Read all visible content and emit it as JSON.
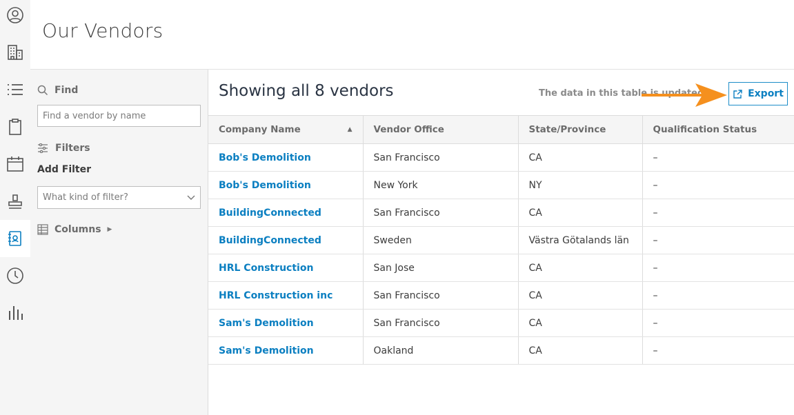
{
  "rail": {
    "icons": [
      "user-circle-icon",
      "building-icon",
      "list-icon",
      "clipboard-icon",
      "calendar-icon",
      "stamp-icon",
      "vendor-book-icon",
      "clock-icon",
      "bar-chart-icon"
    ],
    "active_index": 6
  },
  "page": {
    "title": "Our Vendors"
  },
  "sidebar": {
    "find_label": "Find",
    "find_placeholder": "Find a vendor by name",
    "filters_label": "Filters",
    "add_filter_label": "Add Filter",
    "filter_placeholder": "What kind of filter?",
    "columns_label": "Columns"
  },
  "main": {
    "showing_text": "Showing all 8 vendors",
    "notice_text": "The data in this table is updated",
    "export_label": "Export",
    "columns": [
      "Company Name",
      "Vendor Office",
      "State/Province",
      "Qualification Status"
    ],
    "rows": [
      {
        "company": "Bob's Demolition",
        "office": "San Francisco",
        "state": "CA",
        "status": "–"
      },
      {
        "company": "Bob's Demolition",
        "office": "New York",
        "state": "NY",
        "status": "–"
      },
      {
        "company": "BuildingConnected",
        "office": "San Francisco",
        "state": "CA",
        "status": "–"
      },
      {
        "company": "BuildingConnected",
        "office": "Sweden",
        "state": "Västra Götalands län",
        "status": "–"
      },
      {
        "company": "HRL Construction",
        "office": "San Jose",
        "state": "CA",
        "status": "–"
      },
      {
        "company": "HRL Construction inc",
        "office": "San Francisco",
        "state": "CA",
        "status": "–"
      },
      {
        "company": "Sam's Demolition",
        "office": "San Francisco",
        "state": "CA",
        "status": "–"
      },
      {
        "company": "Sam's Demolition",
        "office": "Oakland",
        "state": "CA",
        "status": "–"
      }
    ]
  },
  "colors": {
    "accent": "#0b7fc1",
    "annotation_arrow": "#f5901e",
    "rail_bg": "#f5f5f5"
  }
}
